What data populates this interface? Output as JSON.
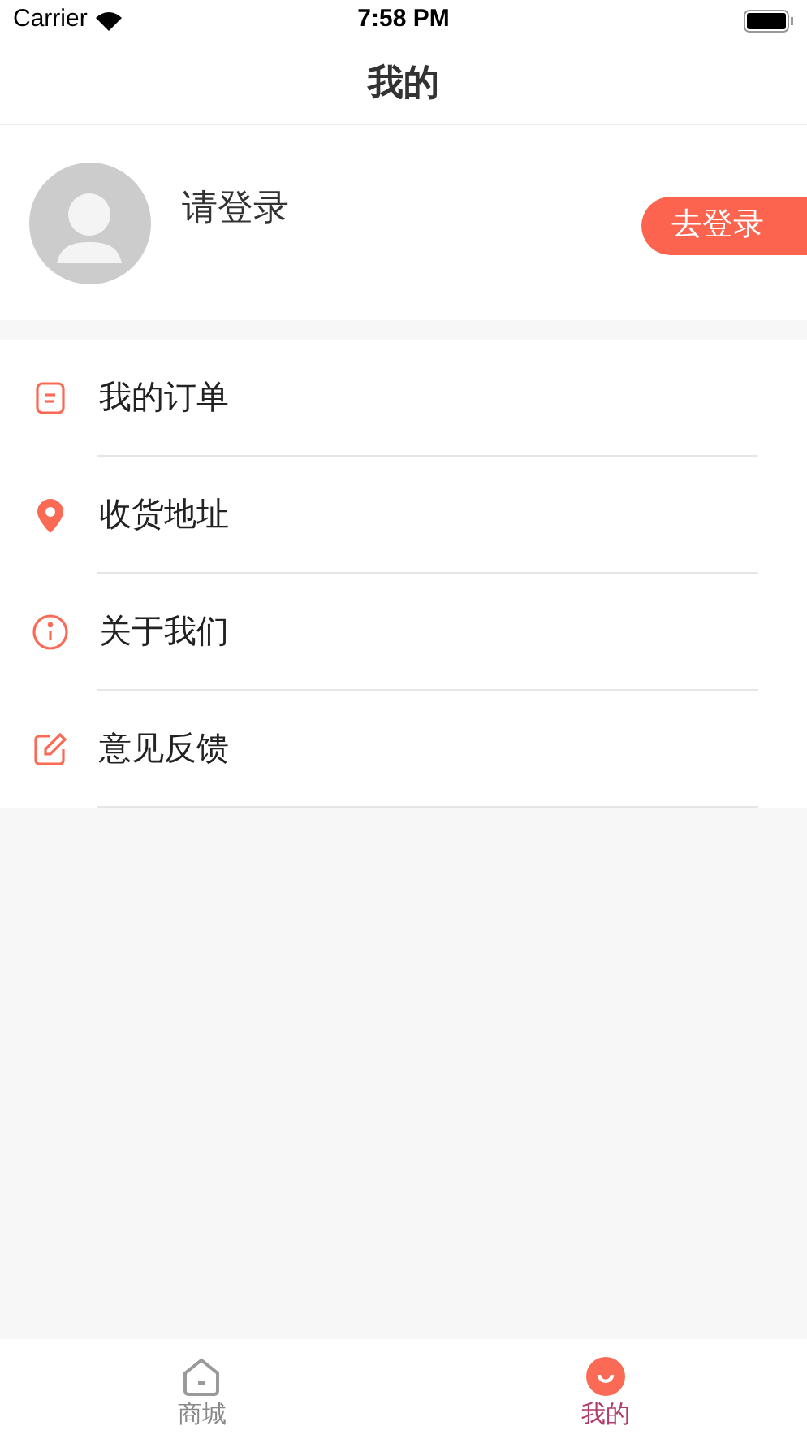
{
  "status_bar": {
    "carrier": "Carrier",
    "time": "7:58 PM"
  },
  "nav": {
    "title": "我的"
  },
  "profile": {
    "name": "请登录",
    "login_button": "去登录"
  },
  "menu": [
    {
      "kind": "order",
      "label": "我的订单"
    },
    {
      "kind": "address",
      "label": "收货地址"
    },
    {
      "kind": "about",
      "label": "关于我们"
    },
    {
      "kind": "feedback",
      "label": "意见反馈"
    }
  ],
  "tabs": [
    {
      "kind": "home",
      "label": "商城",
      "selected": false
    },
    {
      "kind": "mine",
      "label": "我的",
      "selected": true
    }
  ]
}
